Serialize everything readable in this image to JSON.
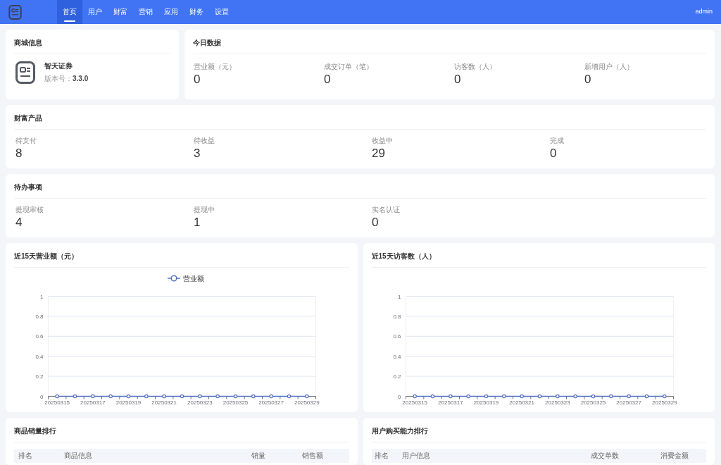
{
  "navbar": {
    "tabs": [
      {
        "label": "首页",
        "selected": true
      },
      {
        "label": "用户",
        "selected": false
      },
      {
        "label": "财富",
        "selected": false
      },
      {
        "label": "营销",
        "selected": false
      },
      {
        "label": "应用",
        "selected": false
      },
      {
        "label": "财务",
        "selected": false
      },
      {
        "label": "设置",
        "selected": false
      }
    ],
    "user": "admin"
  },
  "shop_info": {
    "title": "商城信息",
    "name": "智天证券",
    "version": "版本号：**3.3.0**"
  },
  "today_data": {
    "title": "今日数据",
    "items": [
      {
        "label": "营业额（元）",
        "value": "0"
      },
      {
        "label": "成交订单（笔）",
        "value": "0"
      },
      {
        "label": "访客数（人）",
        "value": "0"
      },
      {
        "label": "新增用户（人）",
        "value": "0"
      }
    ]
  },
  "wealth_products": {
    "title": "财富产品",
    "items": [
      {
        "label": "待支付",
        "value": "8"
      },
      {
        "label": "待收益",
        "value": "3"
      },
      {
        "label": "收益中",
        "value": "29"
      },
      {
        "label": "完成",
        "value": "0"
      }
    ]
  },
  "todo": {
    "title": "待办事项",
    "items": [
      {
        "label": "提现审核",
        "value": "4"
      },
      {
        "label": "提现中",
        "value": "1"
      },
      {
        "label": "实名认证",
        "value": "0"
      }
    ]
  },
  "charts": [
    {
      "title": "近15天营业额（元）",
      "chart_data": {
        "type": "line",
        "grid": true,
        "categories": [
          "20250315",
          null,
          "20250317",
          null,
          "20250319",
          null,
          "20250321",
          null,
          "20250323",
          null,
          "20250325",
          null,
          "20250327",
          null,
          "20250329"
        ],
        "ylim": [
          0,
          1
        ],
        "yticks": [
          0,
          0.2,
          0.4,
          0.6,
          0.8,
          1
        ],
        "series": [
          {
            "name": "营业额",
            "color": "#5470c6",
            "marker": "circle",
            "values": [
              0,
              0,
              0,
              0,
              0,
              0,
              0,
              0,
              0,
              0,
              0,
              0,
              0,
              0,
              0
            ]
          }
        ]
      }
    },
    {
      "title": "近15天访客数（人）",
      "chart_data": {
        "type": "line",
        "grid": true,
        "categories": [
          "20250315",
          null,
          "20250317",
          null,
          "20250319",
          null,
          "20250321",
          null,
          "20250323",
          null,
          "20250325",
          null,
          "20250327",
          null,
          "20250329"
        ],
        "ylim": [
          0,
          1
        ],
        "yticks": [
          0,
          0.2,
          0.4,
          0.6,
          0.8,
          1
        ],
        "series": [
          {
            "color": "#5470c6",
            "marker": "circle",
            "values": [
              0,
              0,
              0,
              0,
              0,
              0,
              0,
              0,
              0,
              0,
              0,
              0,
              0,
              0,
              0
            ]
          }
        ]
      }
    }
  ],
  "rankings": [
    {
      "title": "商品销量排行",
      "columns": [
        "排名",
        "商品信息",
        "销量",
        "销售额"
      ]
    },
    {
      "title": "用户购买能力排行",
      "columns": [
        "排名",
        "用户信息",
        "成交单数",
        "消费金额"
      ]
    }
  ]
}
